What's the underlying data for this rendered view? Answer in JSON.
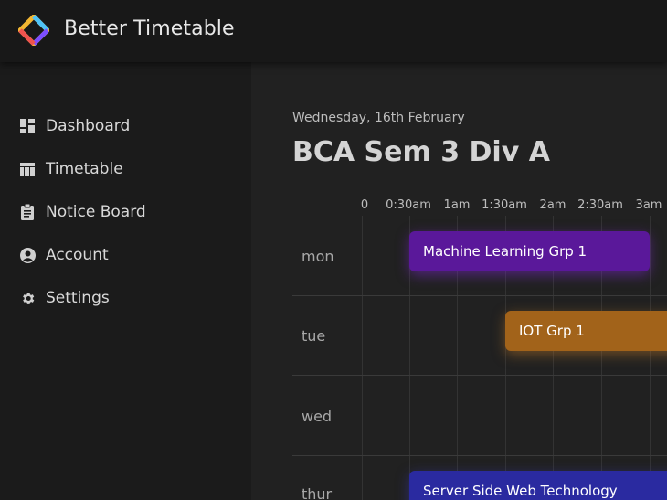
{
  "header": {
    "app_title": "Better Timetable",
    "logo_icon": "better-timetable-logo"
  },
  "sidebar": {
    "items": [
      {
        "label": "Dashboard",
        "icon": "dashboard-icon"
      },
      {
        "label": "Timetable",
        "icon": "table-icon"
      },
      {
        "label": "Notice Board",
        "icon": "clipboard-icon"
      },
      {
        "label": "Account",
        "icon": "account-circle-icon"
      },
      {
        "label": "Settings",
        "icon": "gear-icon"
      }
    ]
  },
  "main": {
    "date": "Wednesday, 16th February",
    "title": "BCA Sem 3 Div A"
  },
  "timetable": {
    "time_labels": [
      "0",
      "0:30am",
      "1am",
      "1:30am",
      "2am",
      "2:30am",
      "3am"
    ],
    "days": [
      "mon",
      "tue",
      "wed",
      "thur"
    ],
    "events": [
      {
        "day": "mon",
        "title": "Machine Learning Grp 1",
        "color": "#5a189a"
      },
      {
        "day": "tue",
        "title": "IOT Grp 1",
        "color": "#a2631a"
      },
      {
        "day": "thur",
        "title": "Server Side Web Technology",
        "color": "#2a2aa0"
      }
    ]
  },
  "colors": {
    "background": "#1a1a1a",
    "main_background": "#212121",
    "ml_event": "#5a189a",
    "iot_event": "#a2631a",
    "ssw_event": "#2a2aa0"
  }
}
